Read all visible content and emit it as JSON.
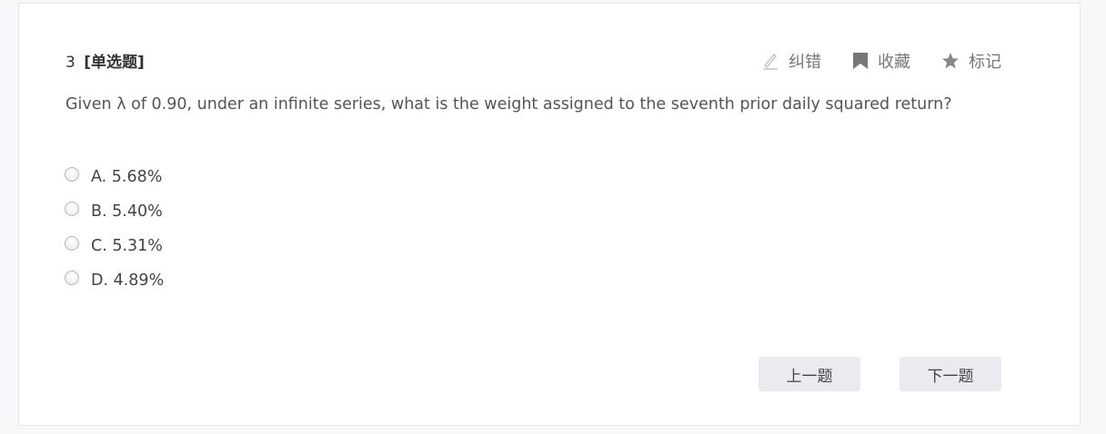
{
  "question": {
    "number": "3",
    "type": "[单选题]",
    "text": "Given λ of 0.90, under an infinite series, what is the weight assigned to the seventh prior daily squared return?"
  },
  "tools": {
    "report_label": "纠错",
    "favorite_label": "收藏",
    "mark_label": "标记"
  },
  "options": [
    {
      "label": "A. 5.68%"
    },
    {
      "label": "B. 5.40%"
    },
    {
      "label": "C. 5.31%"
    },
    {
      "label": "D. 4.89%"
    }
  ],
  "nav": {
    "prev_label": "上一题",
    "next_label": "下一题"
  },
  "icons": {
    "report": "pencil-icon",
    "favorite": "bookmark-icon",
    "mark": "star-icon"
  },
  "colors": {
    "page_bg": "#f7f8fa",
    "card_bg": "#ffffff",
    "button_bg": "#e9ebee",
    "tool_text": "#777777"
  }
}
